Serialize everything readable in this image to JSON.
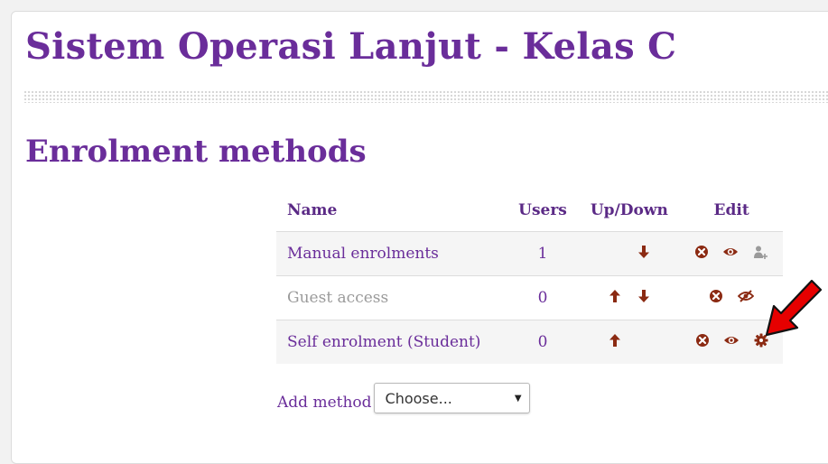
{
  "course": {
    "title": "Sistem Operasi Lanjut - Kelas C"
  },
  "section": {
    "title": "Enrolment methods"
  },
  "table": {
    "headers": {
      "name": "Name",
      "users": "Users",
      "updown": "Up/Down",
      "edit": "Edit"
    },
    "rows": [
      {
        "name": "Manual enrolments",
        "users": "1",
        "up": false,
        "down": true,
        "edit_icons": [
          "delete-icon",
          "eye-icon",
          "enrol-users-icon"
        ],
        "disabled": false
      },
      {
        "name": "Guest access",
        "users": "0",
        "up": true,
        "down": true,
        "edit_icons": [
          "delete-icon",
          "eye-slash-icon"
        ],
        "disabled": true
      },
      {
        "name": "Self enrolment (Student)",
        "users": "0",
        "up": true,
        "down": false,
        "edit_icons": [
          "delete-icon",
          "eye-icon",
          "settings-gear-icon"
        ],
        "disabled": false
      }
    ]
  },
  "add_method": {
    "label": "Add method",
    "selected": "Choose..."
  },
  "colors": {
    "accent": "#6a2d9a",
    "icon": "#8b2a12",
    "pointer": "#e60000"
  }
}
